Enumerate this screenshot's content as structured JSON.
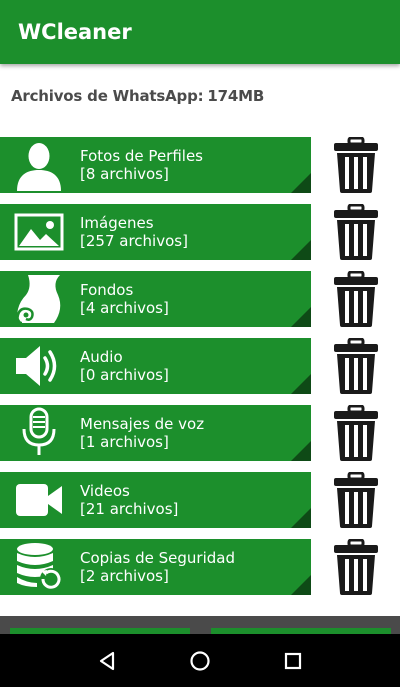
{
  "app": {
    "title": "WCleaner"
  },
  "summary": {
    "label": "Archivos de WhatsApp:",
    "value": "174MB"
  },
  "categories": [
    {
      "name": "Fotos de Perfiles",
      "count": "[8 archivos]",
      "icon": "profile-photo-icon"
    },
    {
      "name": "Imágenes",
      "count": "[257 archivos]",
      "icon": "image-icon"
    },
    {
      "name": "Fondos",
      "count": "[4 archivos]",
      "icon": "wallpaper-icon"
    },
    {
      "name": "Audio",
      "count": "[0 archivos]",
      "icon": "speaker-icon"
    },
    {
      "name": "Mensajes de voz",
      "count": "[1 archivos]",
      "icon": "microphone-icon"
    },
    {
      "name": "Videos",
      "count": "[21 archivos]",
      "icon": "video-camera-icon"
    },
    {
      "name": "Copias de Seguridad",
      "count": "[2 archivos]",
      "icon": "database-restore-icon"
    }
  ],
  "nav": {
    "back": "back-icon",
    "home": "home-icon",
    "recents": "recents-icon"
  },
  "colors": {
    "primary": "#1c8f2c",
    "fold": "#0e4a16",
    "trash": "#1a1a1a"
  }
}
